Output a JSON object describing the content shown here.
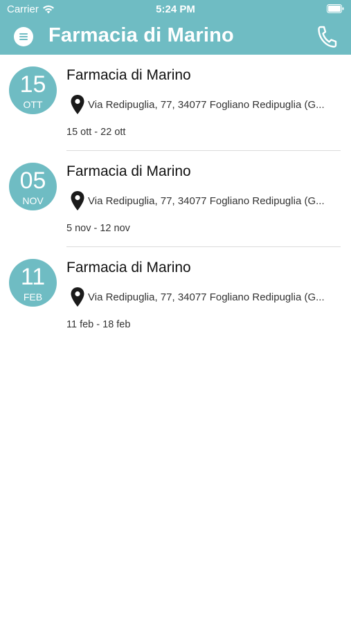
{
  "status_bar": {
    "carrier": "Carrier",
    "time": "5:24 PM"
  },
  "header": {
    "title": "Farmacia di Marino"
  },
  "colors": {
    "accent": "#6fbcc3",
    "text": "#111111",
    "muted_text": "#333333",
    "divider": "#dadada"
  },
  "icons": {
    "menu": "menu-icon",
    "phone": "phone-icon",
    "pin": "location-pin-icon",
    "wifi": "wifi-icon",
    "battery": "battery-icon"
  },
  "shifts": [
    {
      "day": "15",
      "month": "OTT",
      "name": "Farmacia di Marino",
      "address": "Via Redipuglia, 77, 34077 Fogliano Redipuglia (G...",
      "range": "15 ott - 22 ott"
    },
    {
      "day": "05",
      "month": "NOV",
      "name": "Farmacia di Marino",
      "address": "Via Redipuglia, 77, 34077 Fogliano Redipuglia (G...",
      "range": "5 nov - 12 nov"
    },
    {
      "day": "11",
      "month": "FEB",
      "name": "Farmacia di Marino",
      "address": "Via Redipuglia, 77, 34077 Fogliano Redipuglia (G...",
      "range": "11 feb - 18 feb"
    }
  ]
}
